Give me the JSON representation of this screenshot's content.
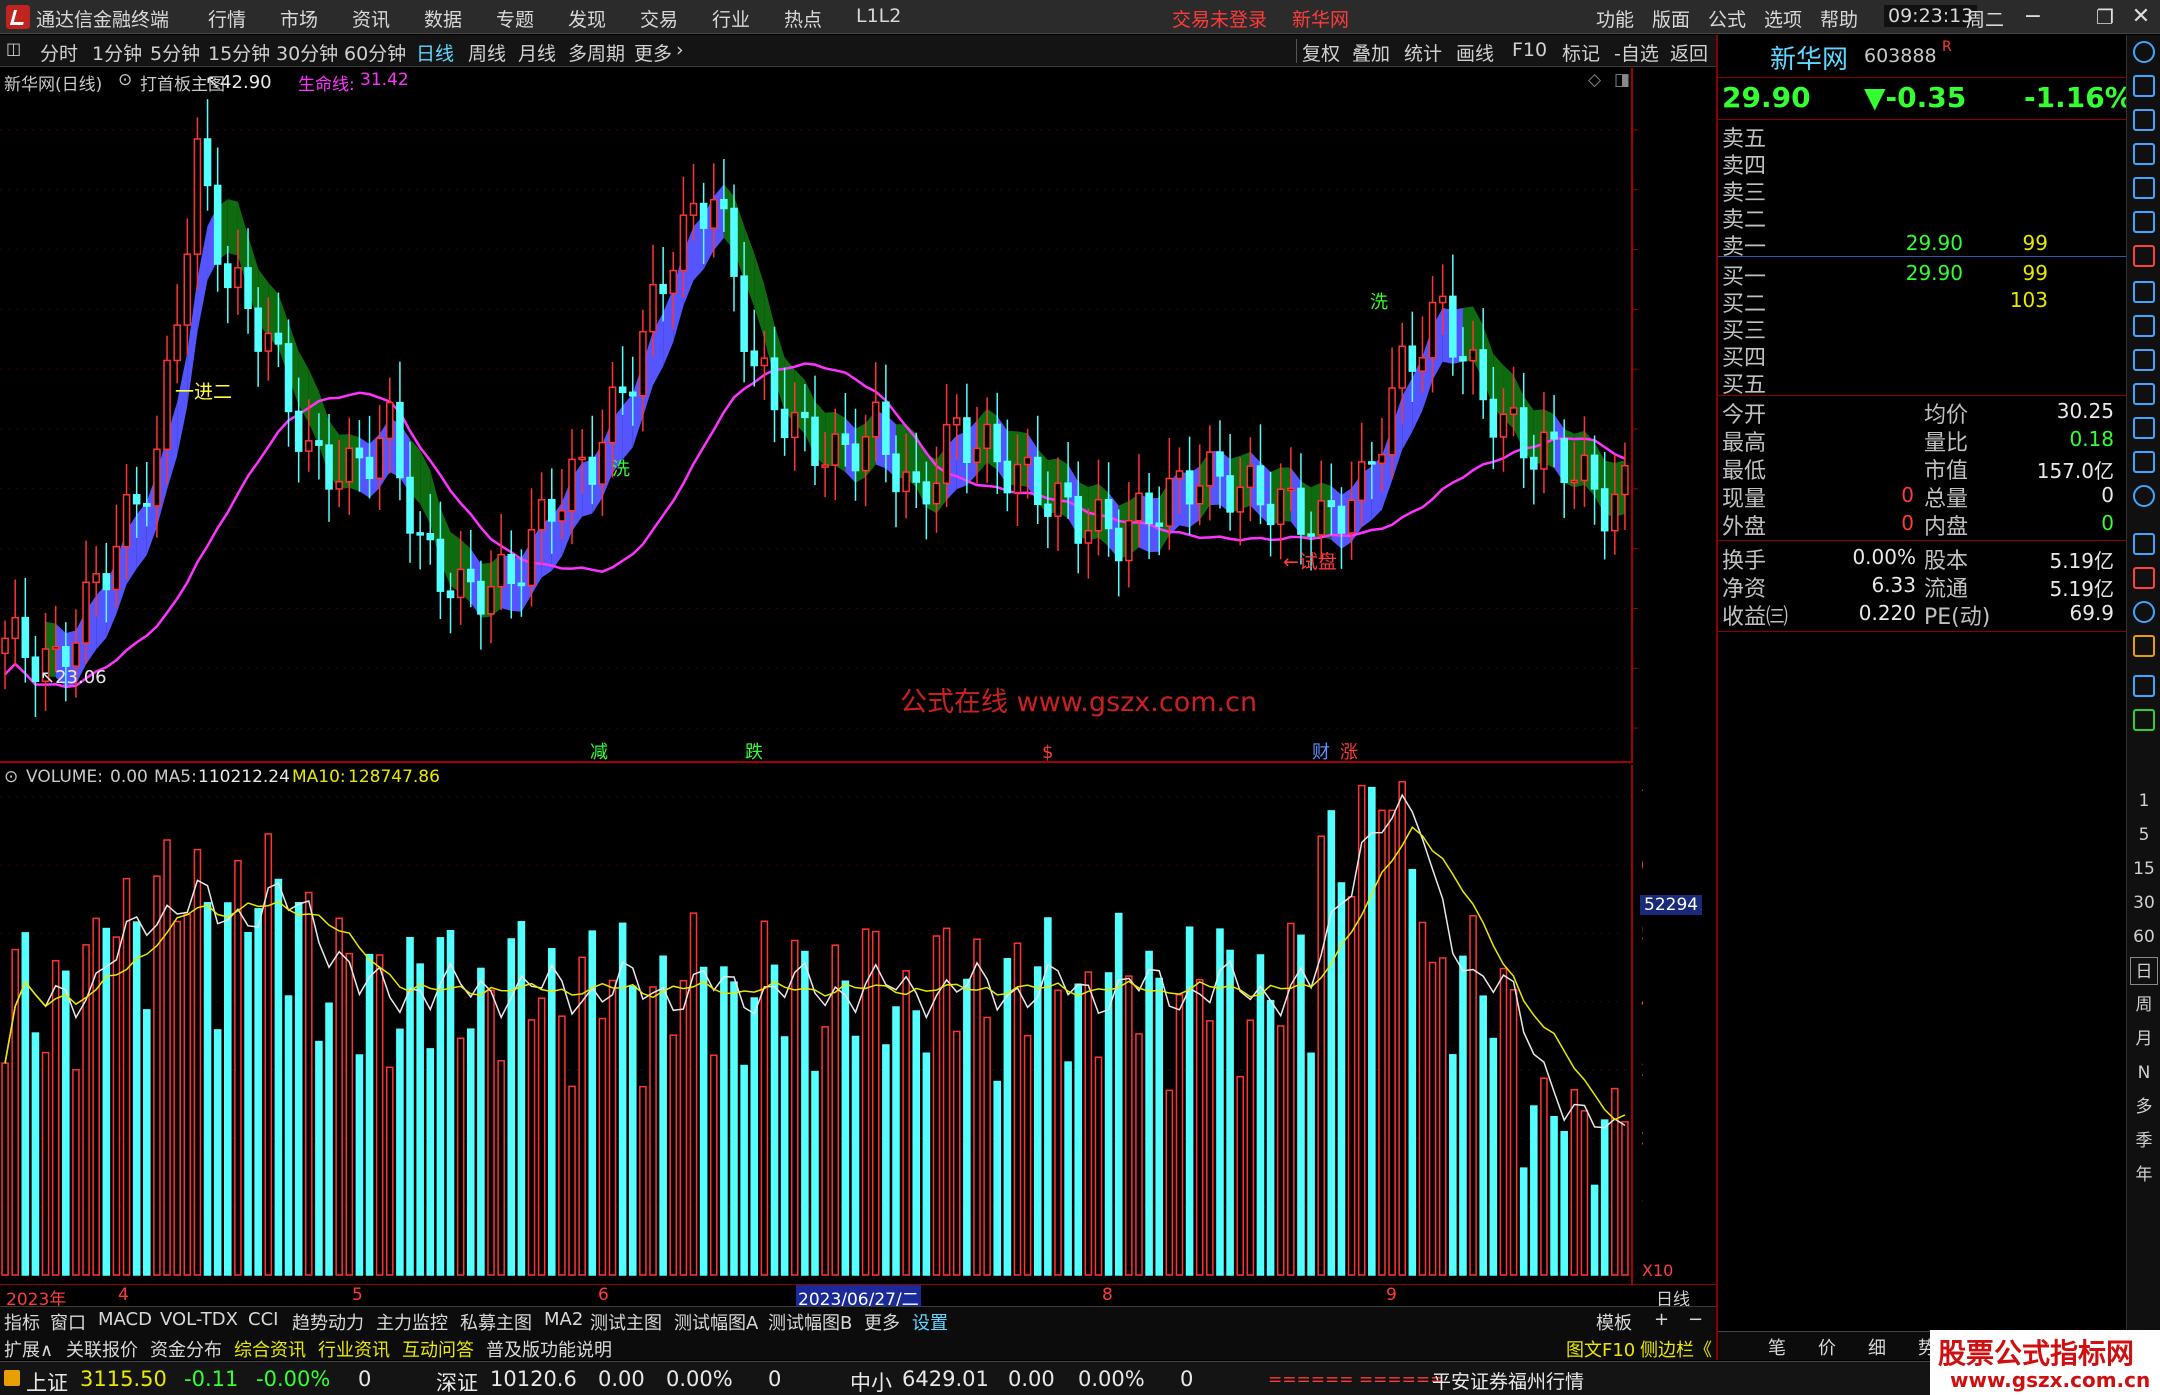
{
  "titlebar": {
    "app": "通达信金融终端",
    "menu": [
      "行情",
      "市场",
      "资讯",
      "数据",
      "专题",
      "发现",
      "交易",
      "行业",
      "热点",
      "L1L2"
    ],
    "login": "交易未登录",
    "stock": "新华网",
    "right": [
      "功能",
      "版面",
      "公式",
      "选项",
      "帮助"
    ],
    "time": "09:23:13",
    "weekday": "周二"
  },
  "toolbar": {
    "periods": [
      "分时",
      "1分钟",
      "5分钟",
      "15分钟",
      "30分钟",
      "60分钟",
      "日线",
      "周线",
      "月线",
      "多周期",
      "更多"
    ],
    "active": "日线",
    "right": [
      "复权",
      "叠加",
      "统计",
      "画线",
      "F10",
      "标记",
      "-自选",
      "返回"
    ]
  },
  "main": {
    "title": "新华网(日线)",
    "formula": "打首板主图",
    "lifeline_label": "生命线:",
    "lifeline_value": "31.42",
    "annot_high": "42.90",
    "annot_low": "23.06",
    "annot_jin": "一进二",
    "annot_shipan": "←试盘",
    "annot_xi1": "洗",
    "annot_xi2": "洗",
    "watermark": "公式在线  www.gszx.com.cn",
    "events": [
      "减",
      "跌",
      "$",
      "财",
      "涨"
    ]
  },
  "volume": {
    "label": "VOLUME:",
    "value": "0.00",
    "ma5_label": "MA5:",
    "ma5": "110212.24",
    "ma10_label": "MA10:",
    "ma10": "128747.86",
    "axis_tag": "52294",
    "x10": "X10"
  },
  "xaxis": {
    "labels": [
      "2023年",
      "4",
      "5",
      "6",
      "2023/06/27/二",
      "8",
      "9"
    ],
    "right": "日线"
  },
  "tabs1": [
    "指标",
    "窗口",
    "MACD",
    "VOL-TDX",
    "CCI",
    "趋势动力",
    "主力监控",
    "私募主图",
    "MA2",
    "测试主图",
    "测试幅图A",
    "测试幅图B",
    "更多",
    "设置"
  ],
  "tabs1_right": [
    "模板",
    "+",
    "−"
  ],
  "tabs2": [
    "扩展∧",
    "关联报价",
    "资金分布",
    "综合资讯",
    "行业资讯",
    "互动问答",
    "普及版功能说明"
  ],
  "tabs2_right": [
    "图文F10",
    "侧边栏《"
  ],
  "quote": {
    "name": "新华网",
    "code": "603888",
    "flag": "R",
    "price": "29.90",
    "change": "▼-0.35",
    "pct": "-1.16%",
    "sell": [
      {
        "label": "卖五",
        "p": "",
        "v": ""
      },
      {
        "label": "卖四",
        "p": "",
        "v": ""
      },
      {
        "label": "卖三",
        "p": "",
        "v": ""
      },
      {
        "label": "卖二",
        "p": "",
        "v": ""
      },
      {
        "label": "卖一",
        "p": "29.90",
        "v": "99"
      }
    ],
    "buy": [
      {
        "label": "买一",
        "p": "29.90",
        "v": "99"
      },
      {
        "label": "买二",
        "p": "",
        "v": "103"
      },
      {
        "label": "买三",
        "p": "",
        "v": ""
      },
      {
        "label": "买四",
        "p": "",
        "v": ""
      },
      {
        "label": "买五",
        "p": "",
        "v": ""
      }
    ],
    "stats": [
      [
        "今开",
        "",
        "均价",
        "30.25"
      ],
      [
        "最高",
        "",
        "量比",
        "0.18"
      ],
      [
        "最低",
        "",
        "市值",
        "157.0亿"
      ],
      [
        "现量",
        "0",
        "总量",
        "0"
      ],
      [
        "外盘",
        "0",
        "内盘",
        "0"
      ]
    ],
    "stats2": [
      [
        "换手",
        "0.00%",
        "股本",
        "5.19亿"
      ],
      [
        "净资",
        "6.33",
        "流通",
        "5.19亿"
      ],
      [
        "收益㈢",
        "0.220",
        "PE(动)",
        "69.9"
      ]
    ]
  },
  "rtabs": [
    "笔",
    "价",
    "细",
    "势"
  ],
  "sidebar": [
    "1",
    "5",
    "15",
    "30",
    "60",
    "日",
    "周",
    "月",
    "N",
    "多",
    "季",
    "年"
  ],
  "status": {
    "sh": "上证",
    "sh_v": "3115.50",
    "sh_c": "-0.11",
    "sh_p": "-0.00%",
    "sh_a": "0",
    "sz": "深证",
    "sz_v": "10120.6",
    "sz_c": "0.00",
    "sz_p": "0.00%",
    "sz_a": "0",
    "zx": "中小",
    "zx_v": "6429.01",
    "zx_c": "0.00",
    "zx_p": "0.00%",
    "zx_a": "0",
    "bars": "====== ======",
    "broker": "平安证券福州行情"
  },
  "brand": {
    "name": "股票公式指标网",
    "url": "www.gszx.com.cn"
  },
  "colors": {
    "up": "#ff3333",
    "down": "#54ffff",
    "ma": "#ff33ff",
    "band_up": "#5555ff",
    "band_down": "#0f6b0f"
  },
  "chart_data": {
    "type": "candlestick",
    "yticks": [
      22,
      24,
      26,
      28,
      30,
      32,
      34,
      36,
      38,
      40,
      42
    ],
    "vol_yticks": [
      10000,
      20000,
      30000,
      40000,
      50000,
      60000,
      70000
    ],
    "price_range": [
      21.0,
      43.4
    ],
    "vol_range": [
      0,
      72000
    ]
  }
}
